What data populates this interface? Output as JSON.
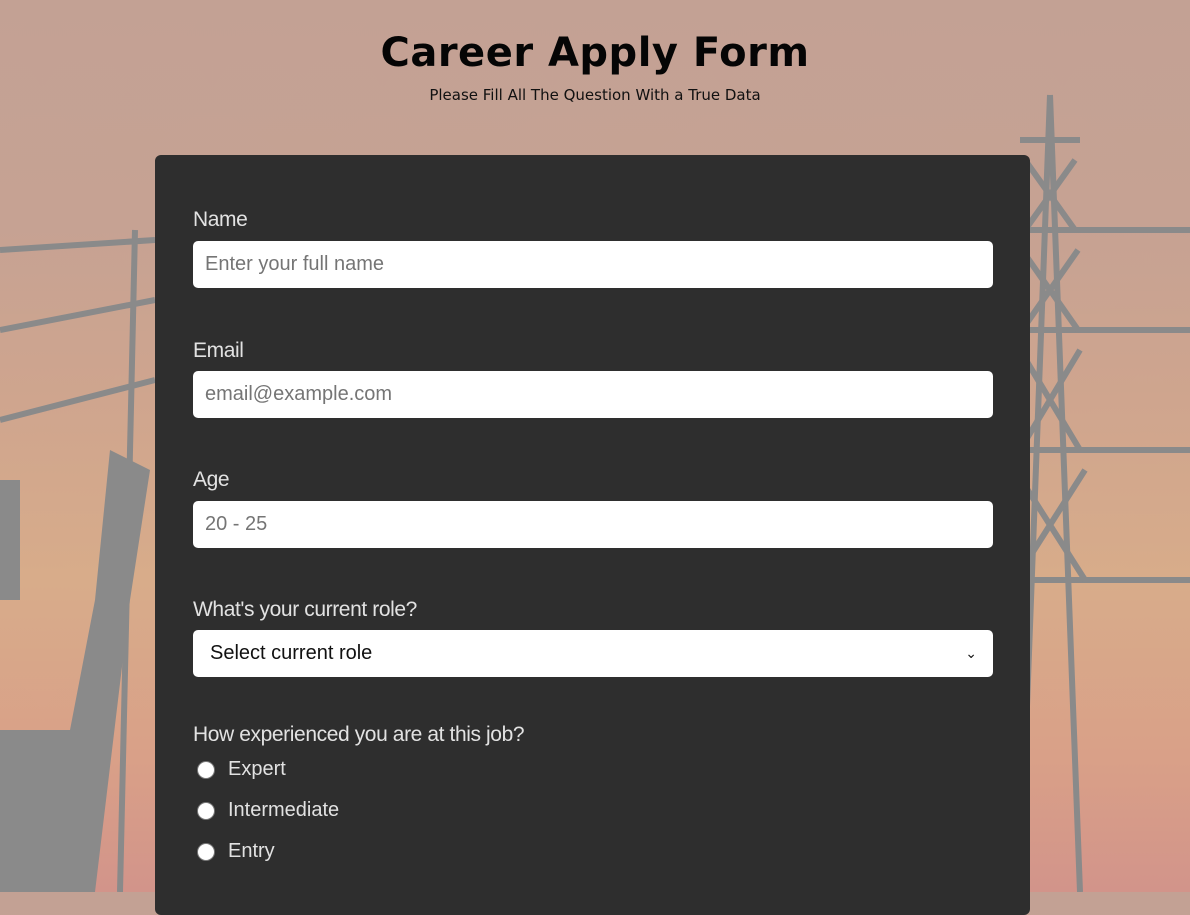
{
  "header": {
    "title": "Career Apply Form",
    "subtitle": "Please Fill All The Question With a True Data"
  },
  "form": {
    "name": {
      "label": "Name",
      "placeholder": "Enter your full name"
    },
    "email": {
      "label": "Email",
      "placeholder": "email@example.com"
    },
    "age": {
      "label": "Age",
      "placeholder": "20 - 25"
    },
    "role": {
      "label": "What's your current role?",
      "selected": "Select current role"
    },
    "experience": {
      "label": "How experienced you are at this job?",
      "options": [
        "Expert",
        "Intermediate",
        "Entry"
      ]
    }
  }
}
